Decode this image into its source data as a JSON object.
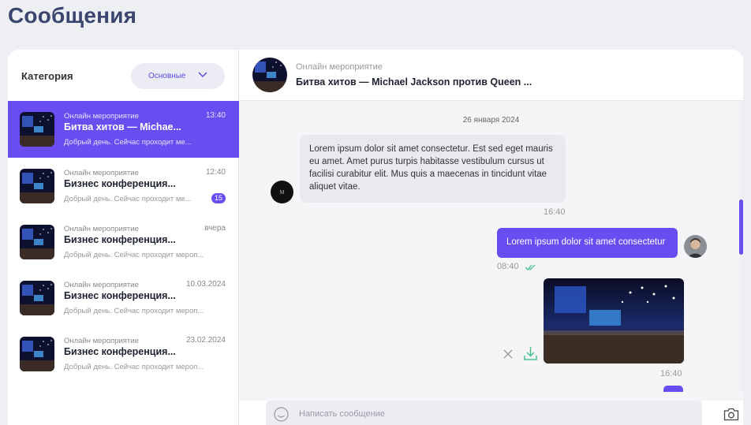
{
  "page": {
    "title": "Сообщения"
  },
  "sidebar": {
    "category_label": "Категория",
    "category_select": "Основные",
    "items": [
      {
        "category": "Онлайн мероприятие",
        "time": "13:40",
        "title": "Битва хитов — Michae...",
        "preview": "Добрый день. Сейчас проходит ме...",
        "active": true,
        "badge": ""
      },
      {
        "category": "Онлайн мероприятие",
        "time": "12:40",
        "title": "Бизнес конференция...",
        "preview": "Добрый день. Сейчас проходит ме...",
        "active": false,
        "badge": "15"
      },
      {
        "category": "Онлайн мероприятие",
        "time": "вчера",
        "title": "Бизнес конференция...",
        "preview": "Добрый день. Сейчас проходит мероп...",
        "active": false,
        "badge": ""
      },
      {
        "category": "Онлайн мероприятие",
        "time": "10.03.2024",
        "title": "Бизнес конференция...",
        "preview": "Добрый день. Сейчас проходит мероп...",
        "active": false,
        "badge": ""
      },
      {
        "category": "Онлайн мероприятие",
        "time": "23.02.2024",
        "title": "Бизнес конференция...",
        "preview": "Добрый день. Сейчас проходит мероп...",
        "active": false,
        "badge": ""
      }
    ]
  },
  "conversation": {
    "category": "Онлайн мероприятие",
    "title": "Битва хитов — Michael Jackson против Queen ...",
    "date": "26 января 2024",
    "incoming": {
      "text": "Lorem ipsum dolor sit amet consectetur. Est sed eget mauris eu amet. Amet purus turpis habitasse vestibulum cursus ut facilisi curabitur elit. Mus quis a maecenas in tincidunt vitae aliquet vitae.",
      "time": "16:40"
    },
    "outgoing": {
      "text": "Lorem ipsum dolor sit amet consectetur",
      "time": "08:40"
    },
    "image_message": {
      "time": "16:40"
    },
    "composer_placeholder": "Написать сообщение"
  },
  "colors": {
    "accent": "#6a4df1",
    "title": "#3a4570",
    "background": "#eeeff3"
  },
  "icons": [
    "chevron-down-icon",
    "double-check-icon",
    "close-icon",
    "download-icon",
    "smile-icon",
    "camera-icon"
  ]
}
